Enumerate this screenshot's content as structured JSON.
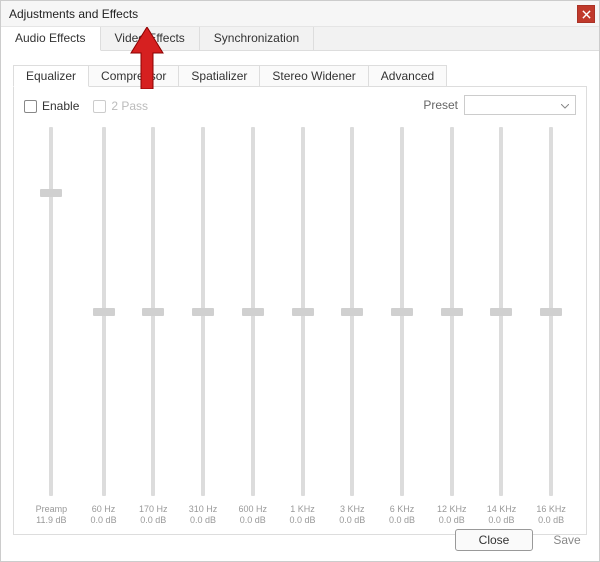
{
  "window": {
    "title": "Adjustments and Effects"
  },
  "tabs_main": {
    "audio": "Audio Effects",
    "video": "Video Effects",
    "sync": "Synchronization"
  },
  "tabs_sub": {
    "equalizer": "Equalizer",
    "compressor": "Compressor",
    "spatializer": "Spatializer",
    "stereo": "Stereo Widener",
    "advanced": "Advanced"
  },
  "options": {
    "enable": "Enable",
    "two_pass": "2 Pass",
    "preset_label": "Preset"
  },
  "eq": {
    "preamp": {
      "label": "Preamp",
      "value": "11.9 dB",
      "thumb_pct": 18
    },
    "bands": [
      {
        "freq": "60 Hz",
        "value": "0.0 dB",
        "thumb_pct": 50
      },
      {
        "freq": "170 Hz",
        "value": "0.0 dB",
        "thumb_pct": 50
      },
      {
        "freq": "310 Hz",
        "value": "0.0 dB",
        "thumb_pct": 50
      },
      {
        "freq": "600 Hz",
        "value": "0.0 dB",
        "thumb_pct": 50
      },
      {
        "freq": "1 KHz",
        "value": "0.0 dB",
        "thumb_pct": 50
      },
      {
        "freq": "3 KHz",
        "value": "0.0 dB",
        "thumb_pct": 50
      },
      {
        "freq": "6 KHz",
        "value": "0.0 dB",
        "thumb_pct": 50
      },
      {
        "freq": "12 KHz",
        "value": "0.0 dB",
        "thumb_pct": 50
      },
      {
        "freq": "14 KHz",
        "value": "0.0 dB",
        "thumb_pct": 50
      },
      {
        "freq": "16 KHz",
        "value": "0.0 dB",
        "thumb_pct": 50
      }
    ]
  },
  "buttons": {
    "close": "Close",
    "save": "Save"
  }
}
